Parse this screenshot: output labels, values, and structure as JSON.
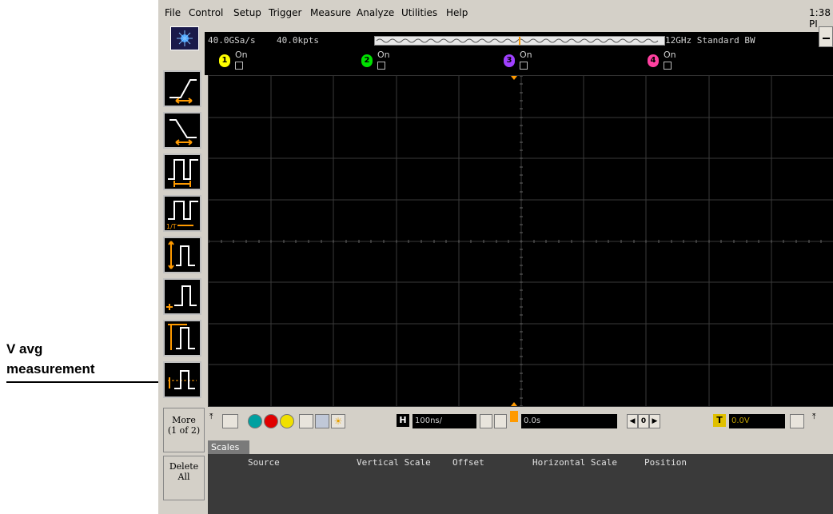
{
  "annotation": {
    "line1": "V avg",
    "line2": "measurement"
  },
  "menu": [
    "File",
    "Control",
    "Setup",
    "Trigger",
    "Measure",
    "Analyze",
    "Utilities",
    "Help"
  ],
  "clock": "1:38 PI",
  "status": {
    "sample_rate": "40.0GSa/s",
    "memory_depth": "40.0kpts",
    "bandwidth": "12GHz Standard BW"
  },
  "channels": [
    {
      "num": "1",
      "label": "On",
      "color": "#ffff00"
    },
    {
      "num": "2",
      "label": "On",
      "color": "#00e000"
    },
    {
      "num": "3",
      "label": "On",
      "color": "#a040ff"
    },
    {
      "num": "4",
      "label": "On",
      "color": "#ff40a0"
    }
  ],
  "tools": [
    "rise-time-icon",
    "fall-time-icon",
    "period-icon",
    "frequency-icon",
    "vpp-icon",
    "vmin-icon",
    "vmax-icon",
    "vavg-icon"
  ],
  "side_buttons": {
    "more": "More",
    "more_page": "(1 of 2)",
    "delete": "Delete",
    "delete2": "All"
  },
  "horizontal": {
    "scale": "100ns/",
    "position": "0.0s",
    "nav_value": "0"
  },
  "trigger": {
    "level": "0.0V"
  },
  "tab": "Scales",
  "table_headers": [
    "Source",
    "Vertical Scale",
    "Offset",
    "Horizontal Scale",
    "Position"
  ],
  "colors": {
    "accent_orange": "#ff9a00",
    "grid": "#3a3a3a",
    "screen": "#000000"
  }
}
